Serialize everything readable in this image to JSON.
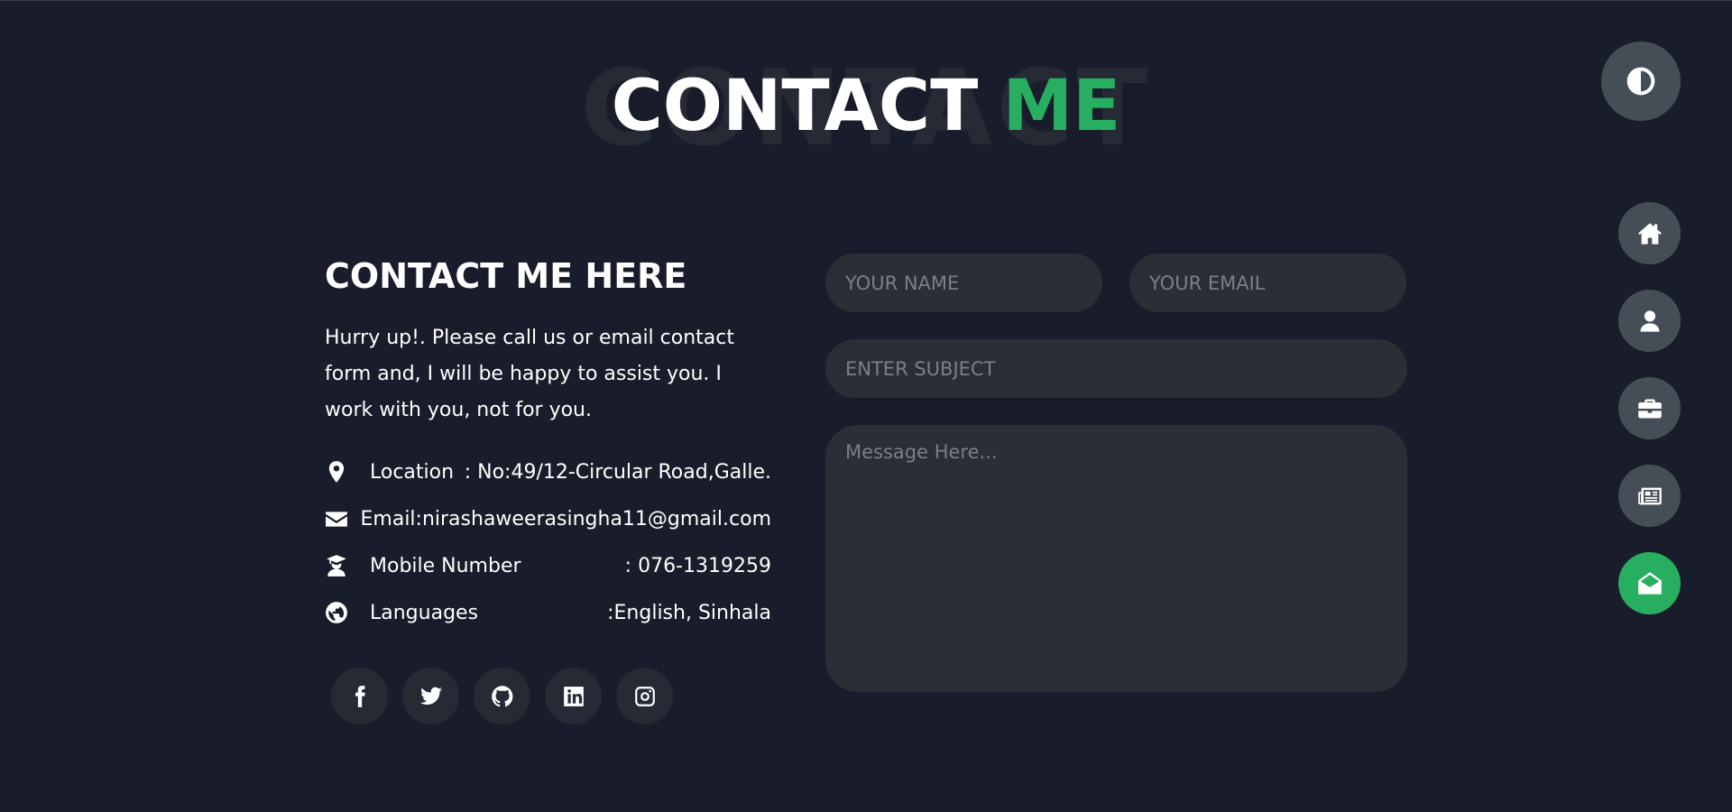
{
  "heading": {
    "background_word": "CONTACT",
    "word1": "CONTACT",
    "word2": "ME"
  },
  "contact": {
    "title": "CONTACT ME HERE",
    "intro": "Hurry up!. Please call us or email contact form and, I will be happy to assist you. I work with you, not for you.",
    "info": [
      {
        "icon": "map-marker-icon",
        "label": "Location",
        "value": ": No:49/12-Circular Road,Galle."
      },
      {
        "icon": "envelope-icon",
        "label": "Email:",
        "value": "nirashaweerasingha11@gmail.com"
      },
      {
        "icon": "user-graduate-icon",
        "label": "Mobile Number",
        "value": ": 076-1319259"
      },
      {
        "icon": "globe-icon",
        "label": "Languages",
        "value": ":English, Sinhala"
      }
    ]
  },
  "social": [
    "facebook-icon",
    "twitter-icon",
    "github-icon",
    "linkedin-icon",
    "instagram-icon"
  ],
  "form": {
    "name_placeholder": "YOUR NAME",
    "email_placeholder": "YOUR EMAIL",
    "subject_placeholder": "ENTER SUBJECT",
    "message_placeholder": "Message Here..."
  },
  "nav": {
    "items": [
      "home-icon",
      "user-icon",
      "briefcase-icon",
      "newspaper-icon",
      "envelope-open-icon"
    ],
    "active": "envelope-open-icon"
  },
  "colors": {
    "background": "#191d2b",
    "accent": "#27ae60",
    "button": "#454e56",
    "field": "#2a2e35"
  }
}
